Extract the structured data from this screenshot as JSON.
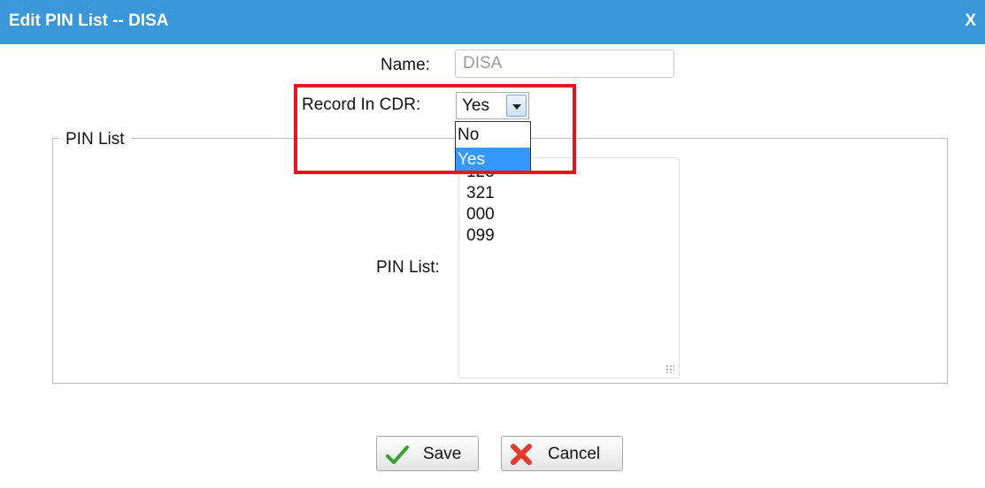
{
  "dialog": {
    "title": "Edit PIN List -- DISA",
    "close_label": "X"
  },
  "form": {
    "name_label": "Name:",
    "name_value": "DISA",
    "record_label": "Record In CDR:",
    "record_selected": "Yes",
    "record_options": [
      "No",
      "Yes"
    ],
    "fieldset_legend": "PIN List",
    "pin_list_label": "PIN List:",
    "pin_entries": [
      "123",
      "321",
      "000",
      "099"
    ]
  },
  "buttons": {
    "save_label": "Save",
    "cancel_label": "Cancel"
  },
  "colors": {
    "title_bar": "#3a97d9",
    "highlight_box": "#e8141e",
    "selected_option": "#3399ff"
  }
}
